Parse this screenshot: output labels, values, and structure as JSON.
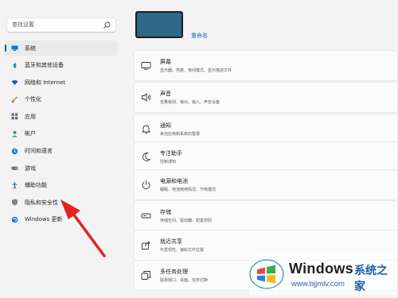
{
  "sidebar": {
    "search_placeholder": "查找设置",
    "items": [
      {
        "label": "系统",
        "icon": "monitor-icon",
        "active": true
      },
      {
        "label": "蓝牙和其他设备",
        "icon": "bluetooth-icon"
      },
      {
        "label": "网络和 Internet",
        "icon": "wifi-icon"
      },
      {
        "label": "个性化",
        "icon": "brush-icon"
      },
      {
        "label": "应用",
        "icon": "apps-icon"
      },
      {
        "label": "帐户",
        "icon": "person-icon"
      },
      {
        "label": "时间和语言",
        "icon": "globe-clock-icon"
      },
      {
        "label": "游戏",
        "icon": "gamepad-icon"
      },
      {
        "label": "辅助功能",
        "icon": "accessibility-icon"
      },
      {
        "label": "隐私和安全性",
        "icon": "shield-icon"
      },
      {
        "label": "Windows 更新",
        "icon": "update-icon"
      }
    ]
  },
  "main": {
    "rename_label": "重命名",
    "cards": [
      {
        "title": "屏幕",
        "desc": "显示器、亮度、夜间模式、显示描述文件",
        "icon": "display-icon"
      },
      {
        "title": "声音",
        "desc": "音量级别、输出、输入、声音设备",
        "icon": "speaker-icon"
      },
      {
        "title": "通知",
        "desc": "来自应用和系统的警报",
        "icon": "bell-icon"
      },
      {
        "title": "专注助手",
        "desc": "控制通知",
        "icon": "moon-icon"
      },
      {
        "title": "电源和电池",
        "desc": "睡眠、电池使用情况、节电模式",
        "icon": "power-icon"
      },
      {
        "title": "存储",
        "desc": "存储空间、驱动器、配置规则",
        "icon": "storage-icon"
      },
      {
        "title": "就近共享",
        "desc": "可发现性、接收文件位置",
        "icon": "share-icon"
      },
      {
        "title": "多任务处理",
        "desc": "贴靠窗口、桌面、任务切换",
        "icon": "multitask-icon"
      }
    ]
  },
  "watermark": {
    "brand": "Windows",
    "brand_cn": "系统之家",
    "url": "www.bjjmlv.com"
  },
  "colors": {
    "accent": "#0067c0",
    "arrow": "#e8211d",
    "thumbnail": "#2e6a86"
  }
}
